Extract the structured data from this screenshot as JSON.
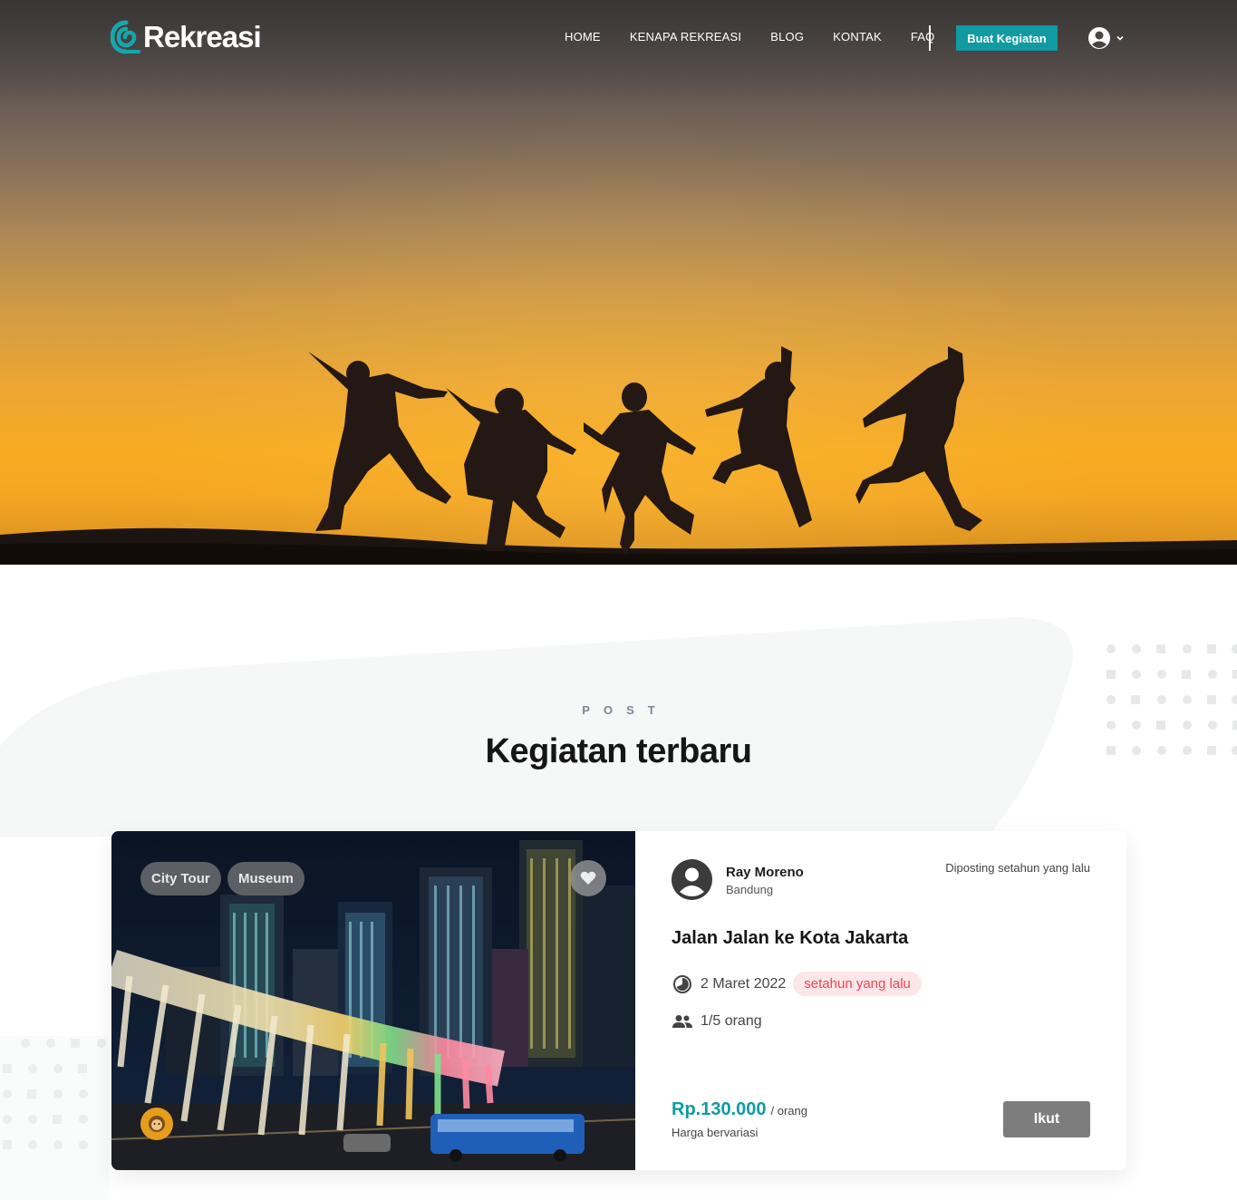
{
  "brand": {
    "name": "Rekreasi",
    "accent": "#119aa2"
  },
  "nav": {
    "links": [
      {
        "label": "HOME"
      },
      {
        "label": "KENAPA REKREASI"
      },
      {
        "label": "BLOG"
      },
      {
        "label": "KONTAK"
      },
      {
        "label": "FAQ"
      }
    ],
    "create_label": "Buat Kegiatan",
    "user_icon": "account-circle-icon"
  },
  "section": {
    "eyebrow": "POST",
    "heading": "Kegiatan terbaru"
  },
  "activity": {
    "tags": [
      "City Tour",
      "Museum"
    ],
    "host_name": "Ray Moreno",
    "host_city": "Bandung",
    "posted": "Diposting setahun yang lalu",
    "title": "Jalan Jalan ke Kota Jakarta",
    "date": "2 Maret 2022",
    "relative_badge": "setahun yang lalu",
    "participants": "1/5 orang",
    "price": "Rp.130.000",
    "price_unit": "/ orang",
    "price_note": "Harga bervariasi",
    "join_label": "Ikut",
    "badge_color": "#e8485a"
  }
}
